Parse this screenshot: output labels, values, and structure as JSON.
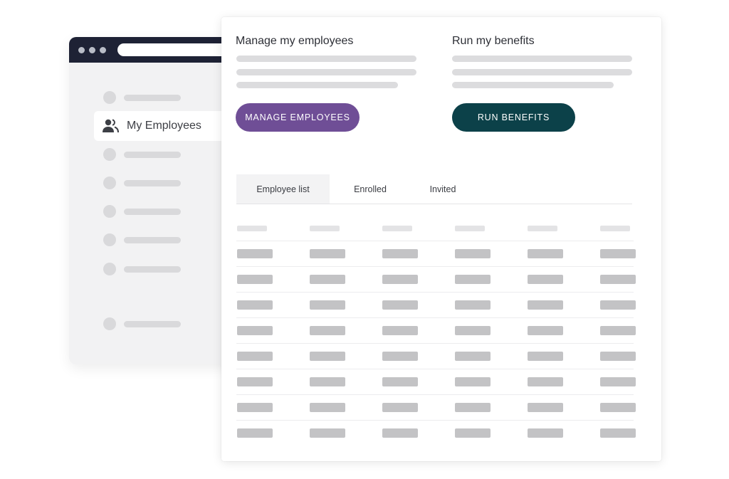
{
  "sidebar": {
    "active_item": {
      "label": "My Employees",
      "icon": "people-icon"
    }
  },
  "manage": {
    "title": "Manage my employees",
    "button_label": "MANAGE EMPLOYEES",
    "button_color": "#6f4e96"
  },
  "benefits": {
    "title": "Run my benefits",
    "button_label": "RUN BENEFITS",
    "button_color": "#0c4149"
  },
  "tabs": [
    {
      "label": "Employee list",
      "active": true
    },
    {
      "label": "Enrolled",
      "active": false
    },
    {
      "label": "Invited",
      "active": false
    }
  ],
  "table": {
    "columns": 6,
    "rows": 8
  }
}
